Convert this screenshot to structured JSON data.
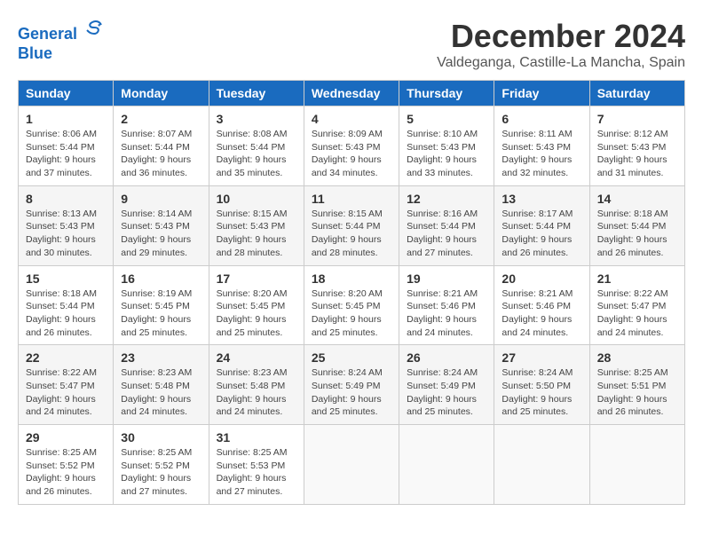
{
  "header": {
    "logo_line1": "General",
    "logo_line2": "Blue",
    "month": "December 2024",
    "location": "Valdeganga, Castille-La Mancha, Spain"
  },
  "weekdays": [
    "Sunday",
    "Monday",
    "Tuesday",
    "Wednesday",
    "Thursday",
    "Friday",
    "Saturday"
  ],
  "weeks": [
    [
      {
        "day": "1",
        "info": "Sunrise: 8:06 AM\nSunset: 5:44 PM\nDaylight: 9 hours and 37 minutes."
      },
      {
        "day": "2",
        "info": "Sunrise: 8:07 AM\nSunset: 5:44 PM\nDaylight: 9 hours and 36 minutes."
      },
      {
        "day": "3",
        "info": "Sunrise: 8:08 AM\nSunset: 5:44 PM\nDaylight: 9 hours and 35 minutes."
      },
      {
        "day": "4",
        "info": "Sunrise: 8:09 AM\nSunset: 5:43 PM\nDaylight: 9 hours and 34 minutes."
      },
      {
        "day": "5",
        "info": "Sunrise: 8:10 AM\nSunset: 5:43 PM\nDaylight: 9 hours and 33 minutes."
      },
      {
        "day": "6",
        "info": "Sunrise: 8:11 AM\nSunset: 5:43 PM\nDaylight: 9 hours and 32 minutes."
      },
      {
        "day": "7",
        "info": "Sunrise: 8:12 AM\nSunset: 5:43 PM\nDaylight: 9 hours and 31 minutes."
      }
    ],
    [
      {
        "day": "8",
        "info": "Sunrise: 8:13 AM\nSunset: 5:43 PM\nDaylight: 9 hours and 30 minutes."
      },
      {
        "day": "9",
        "info": "Sunrise: 8:14 AM\nSunset: 5:43 PM\nDaylight: 9 hours and 29 minutes."
      },
      {
        "day": "10",
        "info": "Sunrise: 8:15 AM\nSunset: 5:43 PM\nDaylight: 9 hours and 28 minutes."
      },
      {
        "day": "11",
        "info": "Sunrise: 8:15 AM\nSunset: 5:44 PM\nDaylight: 9 hours and 28 minutes."
      },
      {
        "day": "12",
        "info": "Sunrise: 8:16 AM\nSunset: 5:44 PM\nDaylight: 9 hours and 27 minutes."
      },
      {
        "day": "13",
        "info": "Sunrise: 8:17 AM\nSunset: 5:44 PM\nDaylight: 9 hours and 26 minutes."
      },
      {
        "day": "14",
        "info": "Sunrise: 8:18 AM\nSunset: 5:44 PM\nDaylight: 9 hours and 26 minutes."
      }
    ],
    [
      {
        "day": "15",
        "info": "Sunrise: 8:18 AM\nSunset: 5:44 PM\nDaylight: 9 hours and 26 minutes."
      },
      {
        "day": "16",
        "info": "Sunrise: 8:19 AM\nSunset: 5:45 PM\nDaylight: 9 hours and 25 minutes."
      },
      {
        "day": "17",
        "info": "Sunrise: 8:20 AM\nSunset: 5:45 PM\nDaylight: 9 hours and 25 minutes."
      },
      {
        "day": "18",
        "info": "Sunrise: 8:20 AM\nSunset: 5:45 PM\nDaylight: 9 hours and 25 minutes."
      },
      {
        "day": "19",
        "info": "Sunrise: 8:21 AM\nSunset: 5:46 PM\nDaylight: 9 hours and 24 minutes."
      },
      {
        "day": "20",
        "info": "Sunrise: 8:21 AM\nSunset: 5:46 PM\nDaylight: 9 hours and 24 minutes."
      },
      {
        "day": "21",
        "info": "Sunrise: 8:22 AM\nSunset: 5:47 PM\nDaylight: 9 hours and 24 minutes."
      }
    ],
    [
      {
        "day": "22",
        "info": "Sunrise: 8:22 AM\nSunset: 5:47 PM\nDaylight: 9 hours and 24 minutes."
      },
      {
        "day": "23",
        "info": "Sunrise: 8:23 AM\nSunset: 5:48 PM\nDaylight: 9 hours and 24 minutes."
      },
      {
        "day": "24",
        "info": "Sunrise: 8:23 AM\nSunset: 5:48 PM\nDaylight: 9 hours and 24 minutes."
      },
      {
        "day": "25",
        "info": "Sunrise: 8:24 AM\nSunset: 5:49 PM\nDaylight: 9 hours and 25 minutes."
      },
      {
        "day": "26",
        "info": "Sunrise: 8:24 AM\nSunset: 5:49 PM\nDaylight: 9 hours and 25 minutes."
      },
      {
        "day": "27",
        "info": "Sunrise: 8:24 AM\nSunset: 5:50 PM\nDaylight: 9 hours and 25 minutes."
      },
      {
        "day": "28",
        "info": "Sunrise: 8:25 AM\nSunset: 5:51 PM\nDaylight: 9 hours and 26 minutes."
      }
    ],
    [
      {
        "day": "29",
        "info": "Sunrise: 8:25 AM\nSunset: 5:52 PM\nDaylight: 9 hours and 26 minutes."
      },
      {
        "day": "30",
        "info": "Sunrise: 8:25 AM\nSunset: 5:52 PM\nDaylight: 9 hours and 27 minutes."
      },
      {
        "day": "31",
        "info": "Sunrise: 8:25 AM\nSunset: 5:53 PM\nDaylight: 9 hours and 27 minutes."
      },
      null,
      null,
      null,
      null
    ]
  ]
}
